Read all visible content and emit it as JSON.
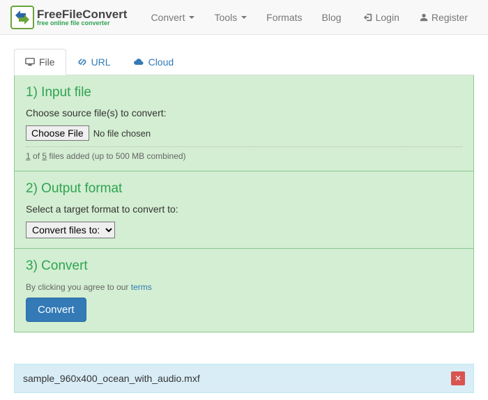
{
  "brand": {
    "title": "FreeFileConvert",
    "subtitle": "free online file converter"
  },
  "nav": {
    "convert": "Convert",
    "tools": "Tools",
    "formats": "Formats",
    "blog": "Blog",
    "login": "Login",
    "register": "Register"
  },
  "tabs": {
    "file": "File",
    "url": "URL",
    "cloud": "Cloud"
  },
  "section1": {
    "heading": "1) Input file",
    "prompt": "Choose source file(s) to convert:",
    "choose_btn": "Choose File",
    "no_file": "No file chosen",
    "added_count": "1",
    "of": "of",
    "max_count": "5",
    "added_suffix": "files added (up to 500 MB combined)"
  },
  "section2": {
    "heading": "2) Output format",
    "prompt": "Select a target format to convert to:",
    "select_label": "Convert files to:"
  },
  "section3": {
    "heading": "3) Convert",
    "agree_prefix": "By clicking you agree to our ",
    "terms": "terms",
    "convert_btn": "Convert"
  },
  "upload": {
    "filename": "sample_960x400_ocean_with_audio.mxf"
  }
}
